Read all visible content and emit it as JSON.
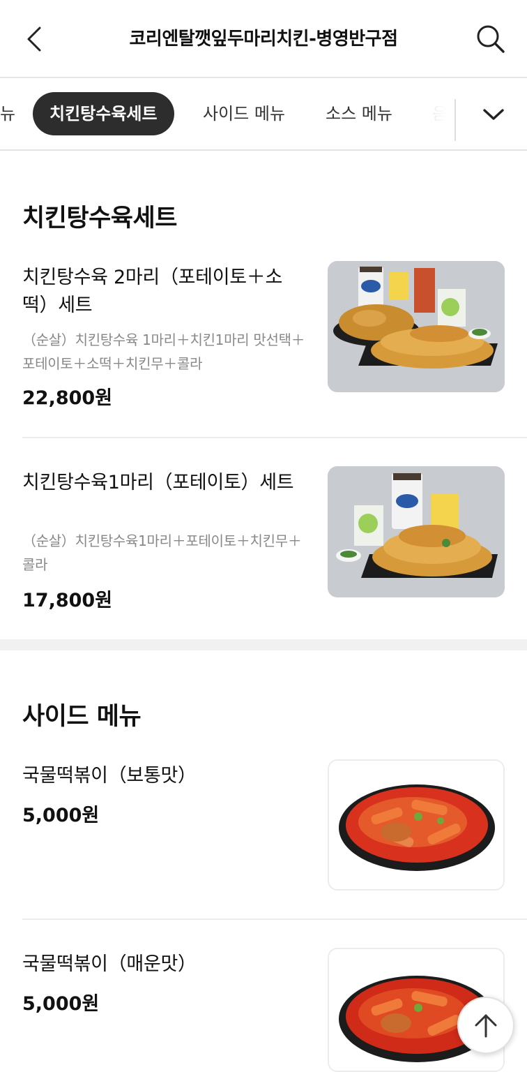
{
  "header": {
    "title": "코리엔탈깻잎두마리치킨-병영반구점",
    "back_icon": "chevron-left-icon",
    "search_icon": "search-icon"
  },
  "tabs": {
    "items": [
      {
        "label": "뉴"
      },
      {
        "label": "치킨탕수육세트",
        "active": true
      },
      {
        "label": "사이드 메뉴"
      },
      {
        "label": "소스 메뉴"
      },
      {
        "label": "음"
      }
    ],
    "expand_icon": "chevron-down-icon"
  },
  "sections": [
    {
      "title": "치킨탕수육세트",
      "items": [
        {
          "name": "치킨탕수육 2마리（포테이토＋소떡）세트",
          "description": "（순살）치킨탕수육 1마리＋치킨1마리 맛선택＋포테이토＋소떡＋치킨무＋콜라",
          "price": "22,800원"
        },
        {
          "name": "치킨탕수육1마리（포테이토）세트",
          "description": "（순살）치킨탕수육1마리＋포테이토＋치킨무＋콜라",
          "price": "17,800원"
        }
      ]
    },
    {
      "title": "사이드 메뉴",
      "items": [
        {
          "name": "국물떡볶이（보통맛）",
          "price": "5,000원"
        },
        {
          "name": "국물떡볶이（매운맛）",
          "price": "5,000원"
        }
      ]
    }
  ],
  "scroll_top_icon": "arrow-up-icon",
  "colors": {
    "active_tab_bg": "#2d2d2d",
    "text_primary": "#111111",
    "text_secondary": "#888888",
    "sauce_red": "#d8321f"
  }
}
